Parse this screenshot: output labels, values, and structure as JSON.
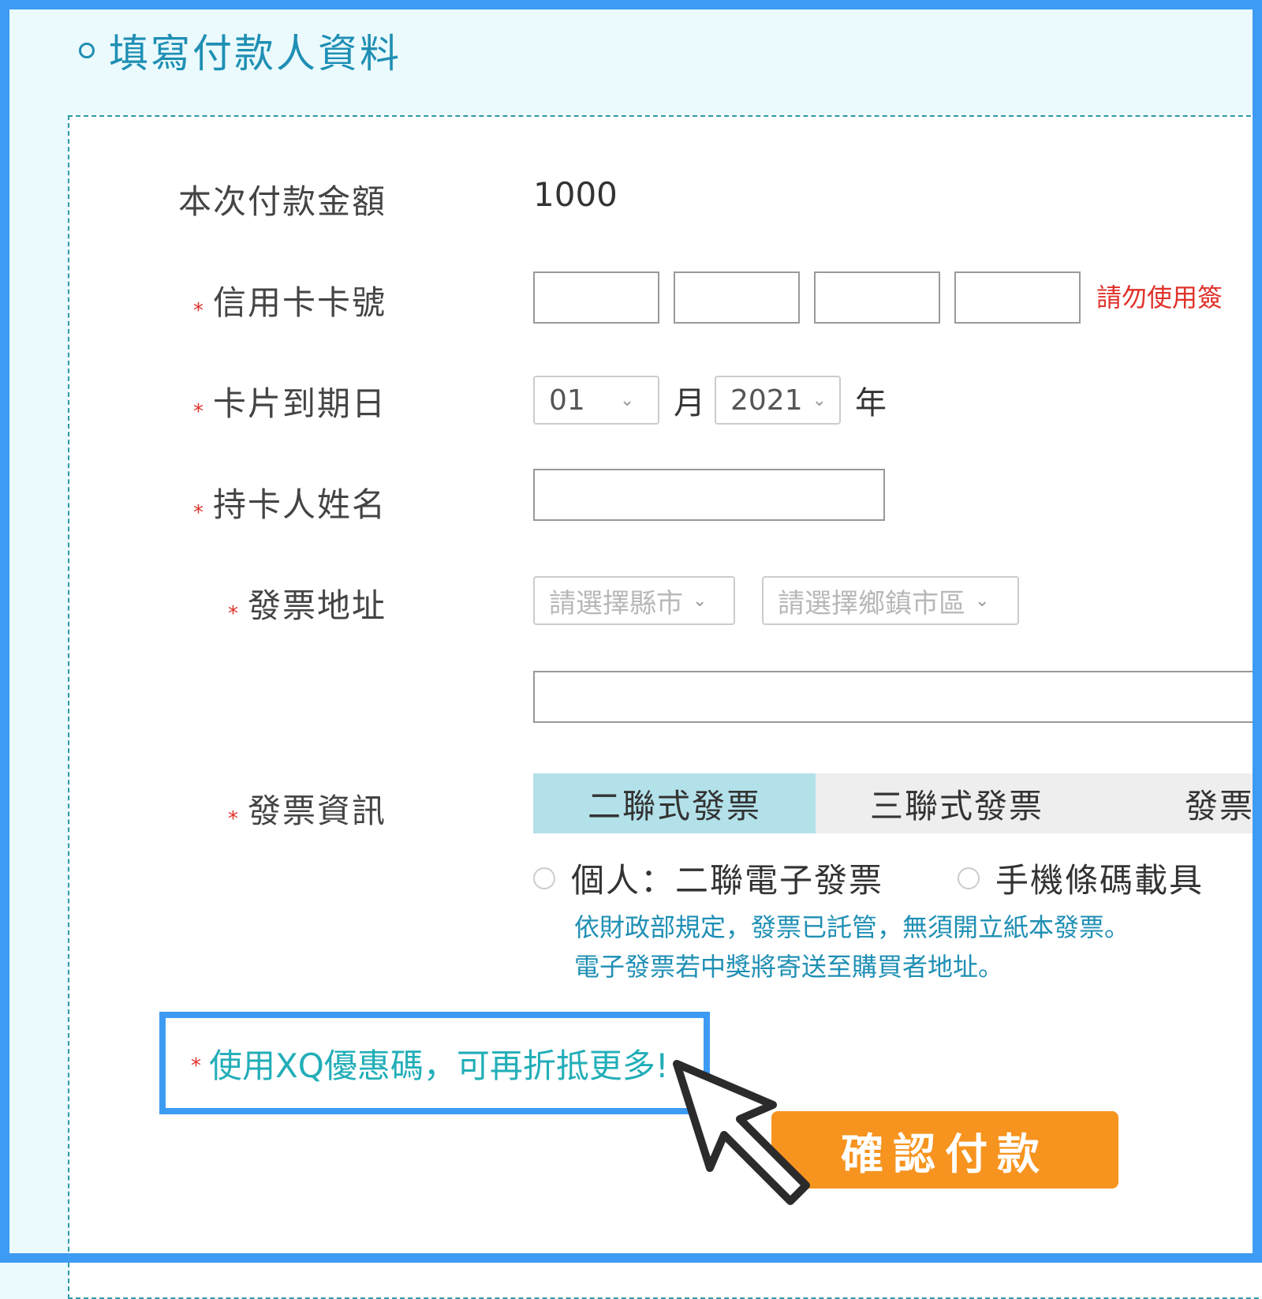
{
  "section_title": "填寫付款人資料",
  "form": {
    "amount_label": "本次付款金額",
    "amount_value": "1000",
    "card_number_label": "信用卡卡號",
    "card_number_note": "請勿使用簽",
    "expiry_label": "卡片到期日",
    "expiry_month": "01",
    "month_unit": "月",
    "expiry_year": "2021",
    "year_unit": "年",
    "holder_label": "持卡人姓名",
    "address_label": "發票地址",
    "city_placeholder": "請選擇縣市",
    "district_placeholder": "請選擇鄉鎮市區",
    "invoice_label": "發票資訊",
    "invoice_tabs": [
      "二聯式發票",
      "三聯式發票",
      "發票"
    ],
    "radio_personal": "個人：二聯電子發票",
    "radio_mobile": "手機條碼載具",
    "hint_line1": "依財政部規定，發票已託管，無須開立紙本發票。",
    "hint_line2": "電子發票若中獎將寄送至購買者地址。",
    "promo_link": "使用XQ優惠碼，可再折抵更多!",
    "confirm_button": "確認付款",
    "required_mark": "*"
  },
  "colors": {
    "accent": "#1f8fb4",
    "frame": "#3d9bf3",
    "required": "#e0312a",
    "button": "#f6941f",
    "active_tab": "#b3e1ea"
  }
}
